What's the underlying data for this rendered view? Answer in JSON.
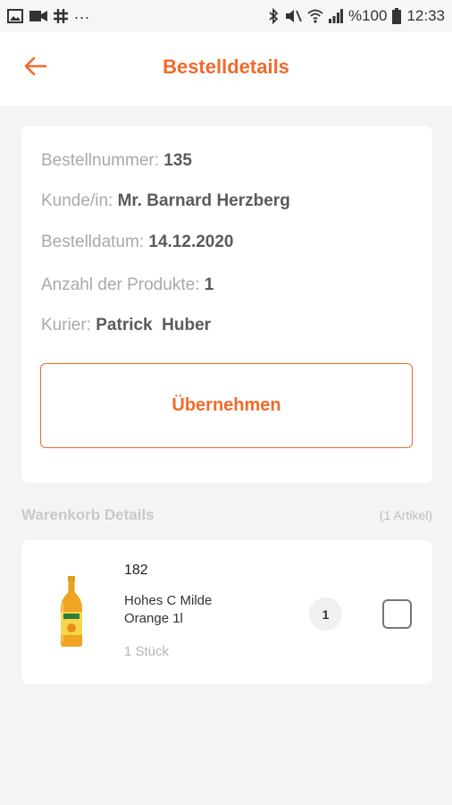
{
  "status_bar": {
    "battery_text": "%100",
    "time": "12:33",
    "dots": "...",
    "icons_left": [
      "image-icon",
      "video-icon",
      "slack-icon"
    ],
    "icons_right": [
      "bluetooth-icon",
      "mute-icon",
      "wifi-icon",
      "signal-icon",
      "battery-icon"
    ]
  },
  "header": {
    "title": "Bestelldetails",
    "back_icon": "arrow-left-icon"
  },
  "order": {
    "number_label": "Bestellnummer:",
    "number_value": "135",
    "customer_label": "Kunde/in:",
    "customer_value": "Mr. Barnard Herzberg",
    "date_label": "Bestelldatum:",
    "date_value": "14.12.2020",
    "count_label": "Anzahl der Produkte:",
    "count_value": "1",
    "courier_label": "Kurier:",
    "courier_value": "Patrick  Huber",
    "accept_label": "Übernehmen"
  },
  "cart": {
    "title": "Warenkorb Details",
    "count": "(1 Artikel)",
    "items": [
      {
        "code": "182",
        "name": "Hohes C Milde Orange 1l",
        "unit": "1 Stück",
        "quantity": "1",
        "checked": false
      }
    ]
  },
  "colors": {
    "accent": "#f26a2a",
    "background": "#f4f4f4",
    "card": "#ffffff"
  }
}
